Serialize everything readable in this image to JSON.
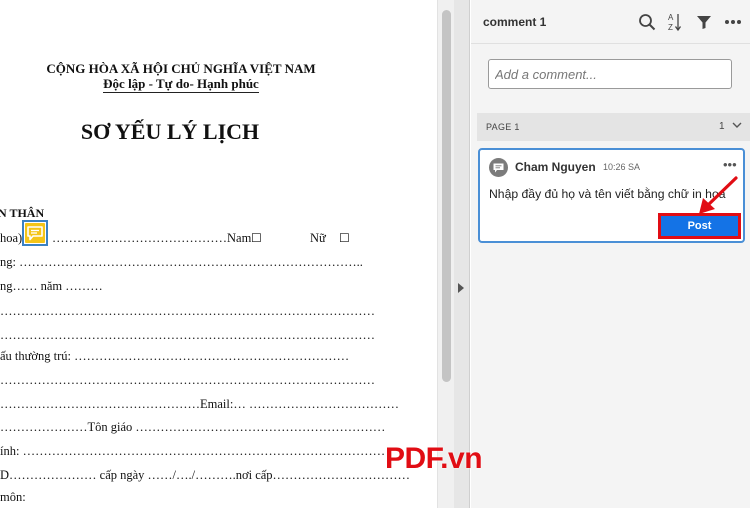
{
  "document": {
    "nation": "CỘNG HÒA XÃ HỘI CHỦ NGHĨA VIỆT NAM",
    "motto": "Độc lập - Tự do- Hạnh phúc",
    "title": "SƠ YẾU LÝ LỊCH",
    "lines": [
      "N THÂN",
      "hoa):",
      "……………………………………Nam",
      "Nữ",
      "ng: ………………………………………………………………………..",
      "ng…… năm ………",
      "………………………………………………………………………………",
      "………………………………………………………………………………",
      "ấu thường trú: …………………………………………………………",
      "………………………………………………………………………………",
      "…………………………………………Email:… ………………………………",
      "…………………Tôn giáo ……………………………………………………",
      "ính: ……………………………………………………………………………",
      "D………………… cấp ngày ……/…./……….nơi cấp……………………………",
      "môn:"
    ]
  },
  "comments_panel": {
    "title": "comment 1",
    "add_placeholder": "Add a comment...",
    "page_label": "PAGE 1",
    "page_count": "1",
    "comment": {
      "author": "Cham Nguyen",
      "time": "10:26 SA",
      "text": "Nhập đầy đủ họ và tên viết bằng chữ in hoa",
      "post_label": "Post",
      "more_label": "•••"
    }
  },
  "watermark": "PDF.vn",
  "colors": {
    "accent": "#1473e6",
    "highlight_red": "#e10d14",
    "comment_marker": "#f5c518"
  }
}
